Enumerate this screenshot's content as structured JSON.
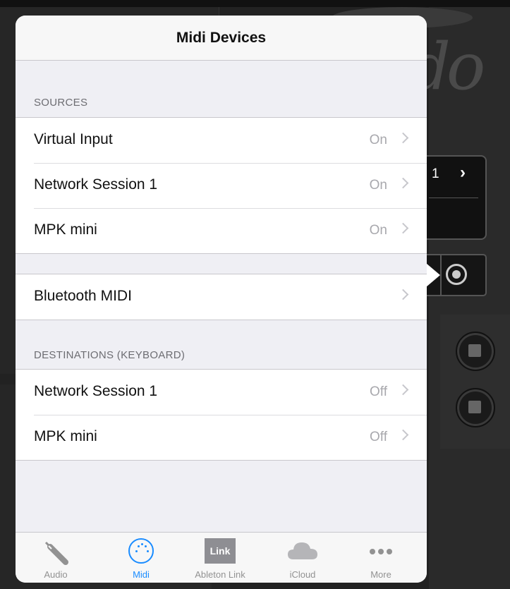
{
  "background": {
    "logo_text": "do",
    "selector_value": "1"
  },
  "popover": {
    "title": "Midi Devices",
    "sources": {
      "header": "SOURCES",
      "items": [
        {
          "label": "Virtual Input",
          "detail": "On"
        },
        {
          "label": "Network Session 1",
          "detail": "On"
        },
        {
          "label": "MPK mini",
          "detail": "On"
        }
      ]
    },
    "bluetooth": {
      "label": "Bluetooth MIDI",
      "detail": ""
    },
    "destinations": {
      "header": "DESTINATIONS (KEYBOARD)",
      "items": [
        {
          "label": "Network Session 1",
          "detail": "Off"
        },
        {
          "label": "MPK mini",
          "detail": "Off"
        }
      ]
    }
  },
  "tab_bar": {
    "active_color": "#1a8cff",
    "tabs": [
      {
        "label": "Audio",
        "icon": "audio-jack-icon"
      },
      {
        "label": "Midi",
        "icon": "midi-din-icon"
      },
      {
        "label": "Ableton Link",
        "icon": "link-icon",
        "icon_text": "Link"
      },
      {
        "label": "iCloud",
        "icon": "cloud-icon"
      },
      {
        "label": "More",
        "icon": "more-dots-icon"
      }
    ]
  }
}
